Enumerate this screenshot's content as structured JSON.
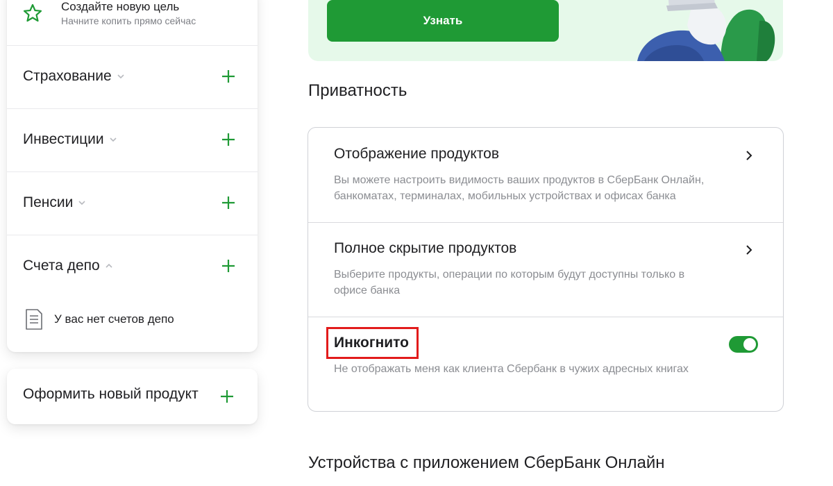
{
  "sidebar": {
    "goal": {
      "title": "Создайте новую цель",
      "subtitle": "Начните копить прямо сейчас",
      "icon": "star-icon"
    },
    "sections": [
      {
        "label": "Страхование",
        "expanded": false
      },
      {
        "label": "Инвестиции",
        "expanded": false
      },
      {
        "label": "Пенсии",
        "expanded": false
      },
      {
        "label": "Счета депо",
        "expanded": true
      }
    ],
    "depo_empty": "У вас нет счетов депо",
    "new_product": "Оформить новый продукт"
  },
  "promo": {
    "button_label": "Узнать"
  },
  "privacy": {
    "heading": "Приватность",
    "items": [
      {
        "title": "Отображение продуктов",
        "description": "Вы можете настроить видимость ваших продуктов в СберБанк Онлайн, банкоматах, терминалах, мобильных устройствах и офисах банка"
      },
      {
        "title": "Полное скрытие продуктов",
        "description": "Выберите продукты, операции по которым будут доступны только в офисе банка"
      },
      {
        "title": "Инкогнито",
        "description": "Не отображать меня как клиента Сбербанк в чужих адресных книгах",
        "toggle_on": true
      }
    ]
  },
  "devices": {
    "heading": "Устройства с приложением СберБанк Онлайн"
  },
  "colors": {
    "accent": "#1f9a35",
    "promo_bg": "#e6f9ea",
    "highlight": "#e21b1b"
  }
}
